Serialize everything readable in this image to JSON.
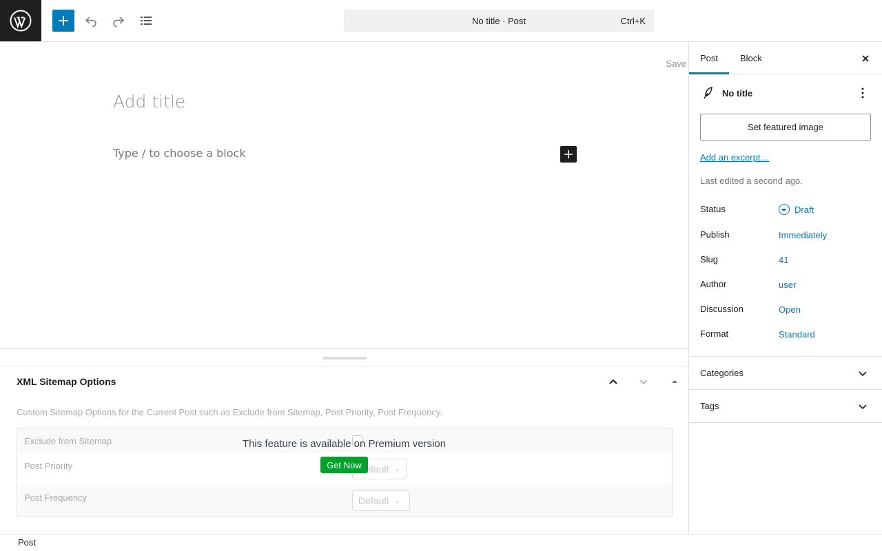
{
  "toolbar": {
    "logo_icon": "wordpress-icon",
    "inserter_icon": "plus-icon",
    "undo_icon": "undo-icon",
    "redo_icon": "redo-icon",
    "list_view_icon": "list-view-icon",
    "command_bar_text": "No title · Post",
    "command_shortcut": "Ctrl+K"
  },
  "editor": {
    "save_label": "Save",
    "title_placeholder": "Add title",
    "block_placeholder": "Type / to choose a block",
    "block_add_icon": "plus-icon"
  },
  "metabox": {
    "title": "XML Sitemap Options",
    "description": "Custom Sitemap Options for the Current Post such as Exclude from Sitemap, Post Priority, Post Frequency.",
    "rows": [
      {
        "label": "Exclude from Sitemap"
      },
      {
        "label": "Post Priority",
        "select_value": "Default"
      },
      {
        "label": "Post Frequency",
        "select_value": "Default"
      }
    ],
    "premium_message": "This feature is available on Premium version",
    "get_now_label": "Get Now"
  },
  "footer": {
    "breadcrumb": "Post"
  },
  "sidebar": {
    "tabs": [
      {
        "label": "Post",
        "active": true
      },
      {
        "label": "Block",
        "active": false
      }
    ],
    "post_title": "No title",
    "featured_image_label": "Set featured image",
    "excerpt_link": "Add an excerpt…",
    "last_edited": "Last edited a second ago.",
    "properties": [
      {
        "label": "Status",
        "value": "Draft"
      },
      {
        "label": "Publish",
        "value": "Immediately"
      },
      {
        "label": "Slug",
        "value": "41"
      },
      {
        "label": "Author",
        "value": "user"
      },
      {
        "label": "Discussion",
        "value": "Open"
      },
      {
        "label": "Format",
        "value": "Standard"
      }
    ],
    "panels": [
      {
        "label": "Categories"
      },
      {
        "label": "Tags"
      }
    ]
  },
  "colors": {
    "accent": "#007cba",
    "dark": "#1e1e1e",
    "get_now": "#00a32a"
  }
}
